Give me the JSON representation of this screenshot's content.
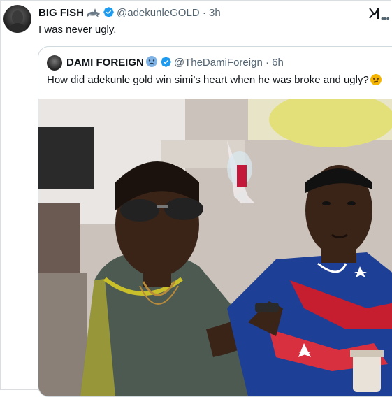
{
  "tweet": {
    "author_name": "BIG FISH",
    "handle": "@adekunleGOLD",
    "separator": "·",
    "time": "3h",
    "text": "I was never ugly."
  },
  "quoted_tweet": {
    "author_name": "DAMI FOREIGN",
    "handle": "@TheDamiForeign",
    "separator": "·",
    "time": "6h",
    "text": "How did adekunle gold win simi’s heart when he was broke and ugly?"
  },
  "icons": {
    "shark": "shark-emoji-icon",
    "verified": "verified-badge-icon",
    "grok": "grok-icon",
    "more": "more-options-icon",
    "sad_face": "sad-face-emoji-icon",
    "thinking": "thinking-face-emoji-icon"
  },
  "colors": {
    "verified": "#1d9bf0",
    "secondary_text": "#536471",
    "primary_text": "#0f1419",
    "border": "#cfd9de"
  }
}
